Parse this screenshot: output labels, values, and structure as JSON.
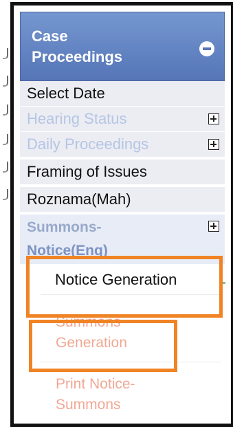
{
  "panel": {
    "title": "Case Proceedings",
    "title_line1": "Case",
    "title_line2": "Proceedings",
    "collapse_icon": "minus-circle-icon"
  },
  "menu": {
    "select_date": "Select Date",
    "hearing_status": "Hearing Status",
    "daily_proceedings": "Daily Proceedings",
    "framing_of_issues": "Framing of Issues",
    "roznama": "Roznama(Mah)",
    "summons_notice_line1": "Summons-",
    "summons_notice_line2": "Notice(Eng)"
  },
  "submenu": {
    "notice_generation": "Notice Generation",
    "summons_generation_line1": "Summons",
    "summons_generation_line2": "Generation",
    "print_notice_line1": "Print Notice-",
    "print_notice_line2": "Summons"
  },
  "colors": {
    "header": "#5f7fc0",
    "highlight": "#f08425",
    "submenu_text": "#f0a894"
  }
}
